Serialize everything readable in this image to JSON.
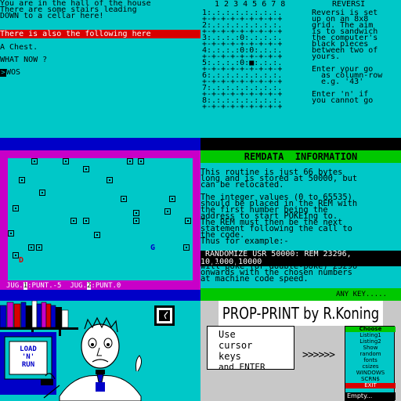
{
  "adventure": {
    "lines": [
      "You are in the hall of the house",
      "There are some stairs leading",
      "DOWN to a cellar here!"
    ],
    "highlight": "There is also the following here",
    "item": "A Chest.",
    "prompt": "WHAT NOW ?",
    "input": "WOS",
    "cursor_glyph": ">"
  },
  "reversi": {
    "col_numbers": "1 2 3 4 5 6 7 8",
    "title": "REVERSI",
    "board_rows": [
      "1:.:.:.:.:.:.:.:.",
      "2:.:.:.:.:.:.:.:.",
      "3:.:.:.:0:.:.:.:.",
      "4:.:.:.:0:0:.:.:.",
      "5:.:.:.:0:■:.:.:.",
      "6:.:.:.:.:.:.:.:.",
      "7:.:.:.:.:.:.:.:.",
      "8:.:.:.:.:.:.:.:."
    ],
    "separator": "+-+-+-+-+-+-+-+-+",
    "info": [
      "Reversi is set",
      "up on an 8x8",
      "grid. The aim",
      "is to sandwich",
      "the computer's",
      "black pieces",
      "between two of",
      "yours.",
      "",
      "Enter your go",
      "  as column-row",
      "  e.g. '43'",
      "",
      "Enter 'n' if",
      "you cannot go"
    ]
  },
  "game": {
    "status_p1_label": "JUG.",
    "status_p1_num": "1",
    "status_p1_text": ":PUNT.-5",
    "status_p2_label": "JUG.",
    "status_p2_num": "2",
    "status_p2_text": ":PUNT.0",
    "player1_glyph": "D",
    "player2_glyph": "G",
    "colors": {
      "border": "#c800c8",
      "field": "#00c8c8",
      "frame": "#0000c8",
      "p1": "#d80000",
      "p2": "#0000c8"
    }
  },
  "remdata": {
    "title": "REMDATA  INFORMATION",
    "lines": [
      "This routine is just 66 bytes",
      "long and is stored at 50000, but",
      "can be relocated.",
      "",
      "The integer values (0 to 65535)",
      "should be placed in the REM with",
      "the first number being the",
      "address to start POKEing to.",
      "The REM must then be the next",
      "statement following the call to",
      "the code.",
      "Thus for example:-"
    ],
    "cmd_line1": " RANDOMIZE USR 50000: REM 23296,",
    "cmd_line2": "10,1000,10000",
    "after_lines": [
      "will poke (or double-poke) 23296",
      "onwards with the chosen numbers",
      "at machine code speed."
    ],
    "any_key": "ANY KEY....."
  },
  "cartoon": {
    "load_run_line1": "LOAD",
    "load_run_line2": "'N'",
    "load_run_line3": "RUN"
  },
  "propprint": {
    "title": "PROP-PRINT by R.Koning",
    "help_lines": [
      "Use",
      "cursor",
      "keys",
      "and ENTER"
    ],
    "arrows": ">>>>>>",
    "menu_header": "Choose",
    "menu_items": [
      "Listing1",
      "Listing2",
      "Show",
      "random",
      "fonts",
      "csizes",
      "WINDOWS",
      "SCRN$"
    ],
    "menu_exit": "EXIT",
    "menu_empty": "Empty..."
  }
}
